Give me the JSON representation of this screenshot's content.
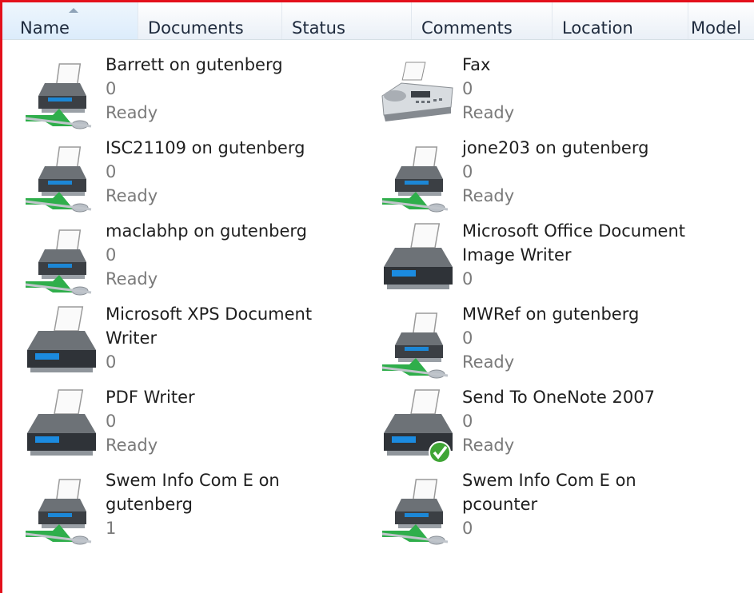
{
  "columns": [
    {
      "label": "Name",
      "sorted": true
    },
    {
      "label": "Documents"
    },
    {
      "label": "Status"
    },
    {
      "label": "Comments"
    },
    {
      "label": "Location"
    },
    {
      "label": "Model"
    }
  ],
  "printers": [
    {
      "name": "Barrett on gutenberg",
      "name2": "",
      "documents": "0",
      "status": "Ready",
      "icon": "network-printer-icon"
    },
    {
      "name": "Fax",
      "name2": "",
      "documents": "0",
      "status": "Ready",
      "icon": "fax-icon"
    },
    {
      "name": "ISC21109 on gutenberg",
      "name2": "",
      "documents": "0",
      "status": "Ready",
      "icon": "network-printer-icon"
    },
    {
      "name": "jone203 on gutenberg",
      "name2": "",
      "documents": "0",
      "status": "Ready",
      "icon": "network-printer-icon"
    },
    {
      "name": "maclabhp on gutenberg",
      "name2": "",
      "documents": "0",
      "status": "Ready",
      "icon": "network-printer-icon"
    },
    {
      "name": "Microsoft Office Document",
      "name2": "Image Writer",
      "documents": "0",
      "status": "",
      "icon": "printer-icon"
    },
    {
      "name": "Microsoft XPS Document",
      "name2": "Writer",
      "documents": "0",
      "status": "",
      "icon": "printer-icon"
    },
    {
      "name": "MWRef on gutenberg",
      "name2": "",
      "documents": "0",
      "status": "Ready",
      "icon": "network-printer-icon"
    },
    {
      "name": "PDF Writer",
      "name2": "",
      "documents": "0",
      "status": "Ready",
      "icon": "printer-icon"
    },
    {
      "name": "Send To OneNote 2007",
      "name2": "",
      "documents": "0",
      "status": "Ready",
      "icon": "default-printer-icon"
    },
    {
      "name": "Swem Info Com E on",
      "name2": "gutenberg",
      "documents": "1",
      "status": "",
      "icon": "network-printer-icon"
    },
    {
      "name": "Swem Info Com E on",
      "name2": "pcounter",
      "documents": "0",
      "status": "",
      "icon": "network-printer-icon"
    }
  ],
  "colors": {
    "accent": "#e3101b",
    "text": "#1f1f1f",
    "muted": "#7a7a7a",
    "header_text": "#1e2a3d",
    "check": "#3fa535"
  }
}
